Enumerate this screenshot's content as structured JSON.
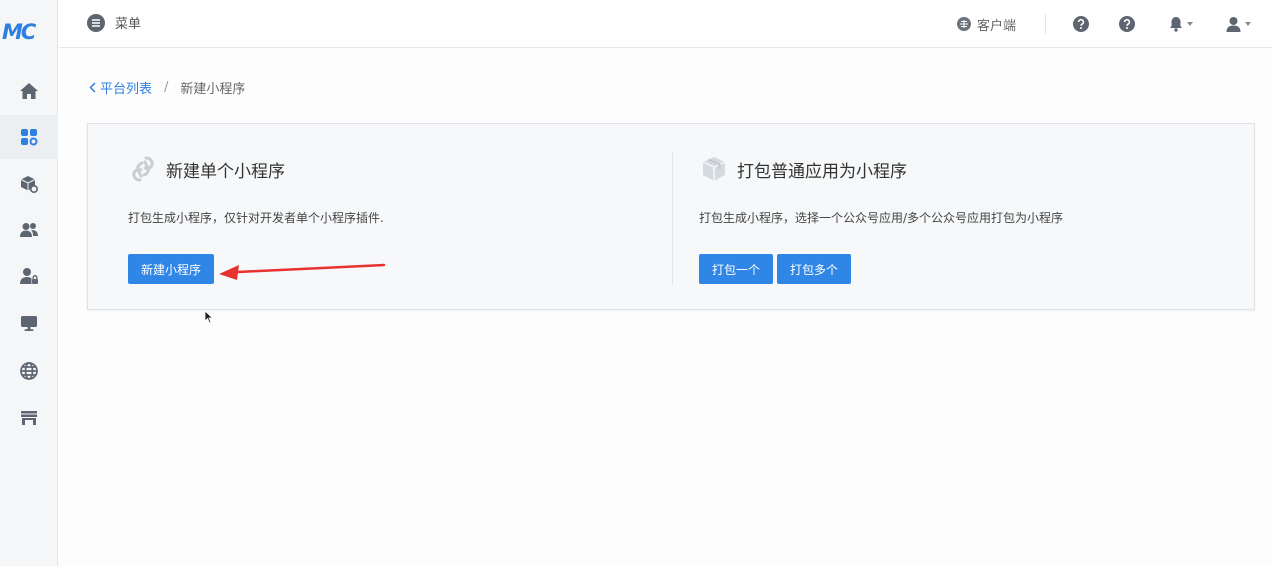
{
  "app": {
    "logo_text": "MC"
  },
  "sidebar": {
    "items": [
      {
        "name": "home",
        "icon": "home-icon"
      },
      {
        "name": "apps",
        "icon": "apps-icon",
        "active": true
      },
      {
        "name": "packages",
        "icon": "box-icon"
      },
      {
        "name": "users",
        "icon": "users-icon"
      },
      {
        "name": "user-lock",
        "icon": "user-lock-icon"
      },
      {
        "name": "monitor",
        "icon": "monitor-icon"
      },
      {
        "name": "globe",
        "icon": "globe-icon"
      },
      {
        "name": "store",
        "icon": "store-icon"
      }
    ]
  },
  "topbar": {
    "menu_label": "菜单",
    "client_label": "客户端"
  },
  "breadcrumb": {
    "parent": "平台列表",
    "separator": "/",
    "current": "新建小程序"
  },
  "cards": {
    "left": {
      "title": "新建单个小程序",
      "description": "打包生成小程序，仅针对开发者单个小程序插件.",
      "button": "新建小程序"
    },
    "right": {
      "title": "打包普通应用为小程序",
      "description": "打包生成小程序，选择一个公众号应用/多个公众号应用打包为小程序",
      "button_one": "打包一个",
      "button_many": "打包多个"
    }
  },
  "colors": {
    "brand": "#2f7fe0",
    "button": "#2f86e6",
    "annotation_arrow": "#e8322f",
    "icon_gray": "#5d6670"
  }
}
